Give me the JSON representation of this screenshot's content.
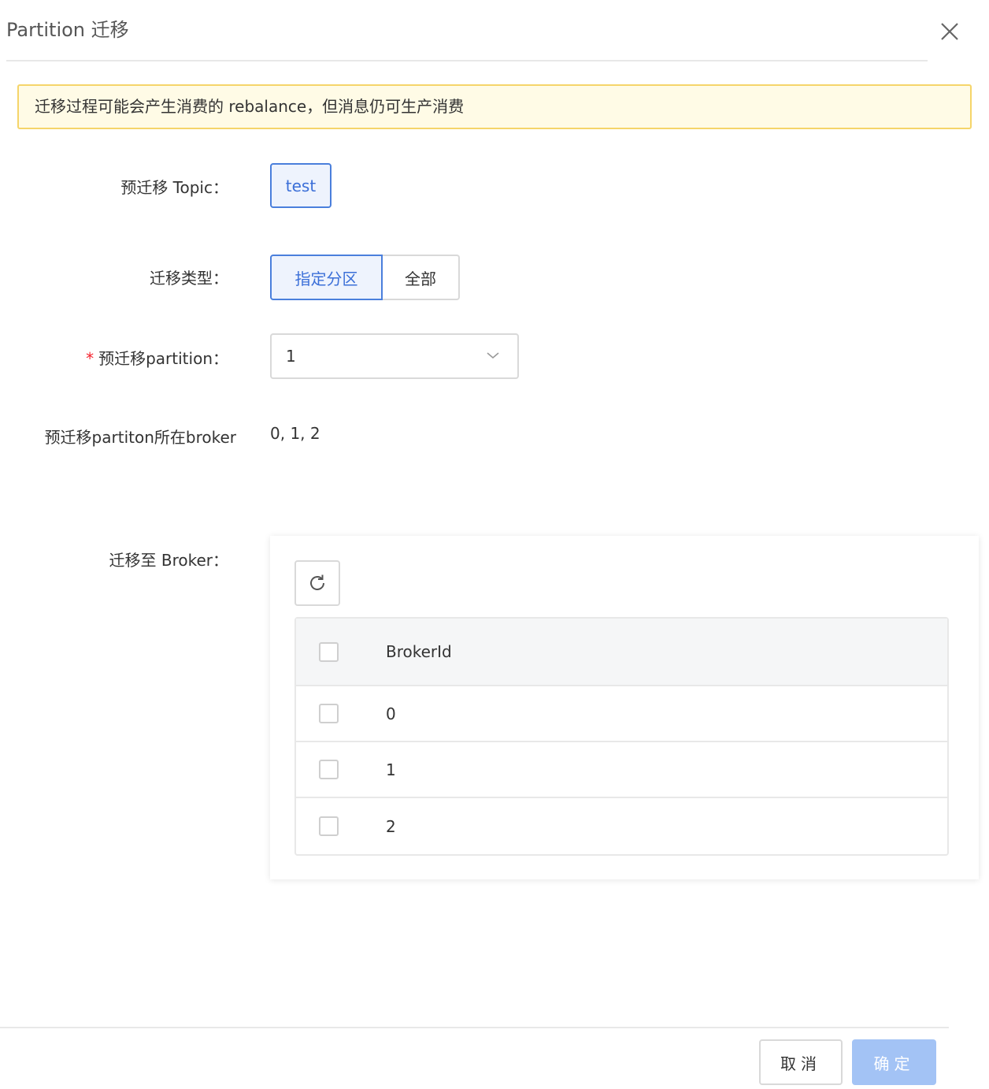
{
  "modal": {
    "title": "Partition 迁移"
  },
  "alert": {
    "message": "迁移过程可能会产生消费的 rebalance，但消息仍可生产消费"
  },
  "form": {
    "topic_label": "预迁移 Topic：",
    "topic_value": "test",
    "type_label": "迁移类型：",
    "type_options": [
      "指定分区",
      "全部"
    ],
    "type_selected": "指定分区",
    "partition_required_mark": "*",
    "partition_label": "预迁移partition：",
    "partition_value": "1",
    "broker_label": "预迁移partiton所在broker",
    "broker_value": "0, 1, 2",
    "target_label": "迁移至 Broker："
  },
  "broker_table": {
    "column": "BrokerId",
    "rows": [
      "0",
      "1",
      "2"
    ]
  },
  "footer": {
    "cancel_label": "取消",
    "ok_label": "确定"
  },
  "colors": {
    "primary": "#3b6fd8",
    "alert_bg": "#fffbe6",
    "alert_border": "#f5d56a",
    "ok_disabled": "#a3c3f5"
  }
}
